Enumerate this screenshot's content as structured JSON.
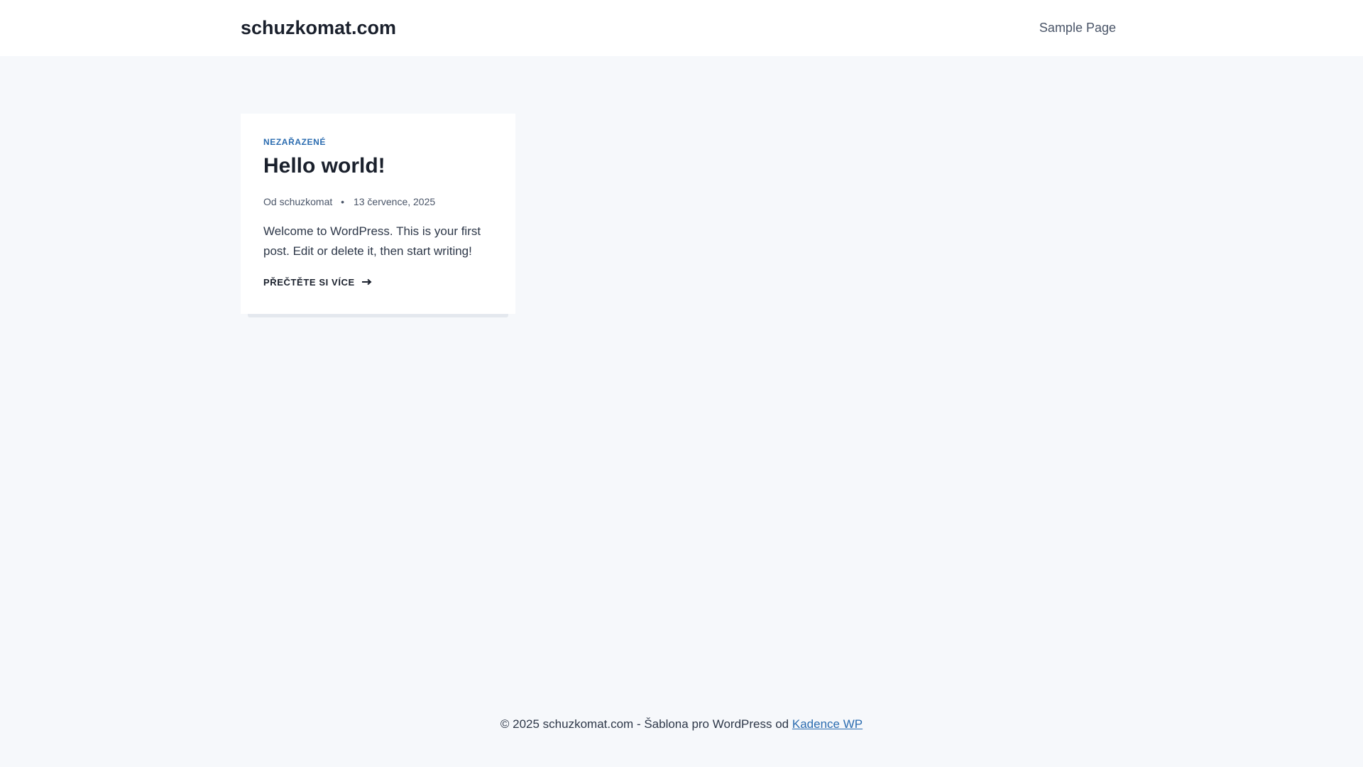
{
  "header": {
    "site_title": "schuzkomat.com",
    "nav": [
      "Sample Page"
    ]
  },
  "post": {
    "category": "NEZAŘAZENÉ",
    "title": "Hello world!",
    "author_prefix": "Od",
    "author": "schuzkomat",
    "separator": "•",
    "date": "13 července, 2025",
    "excerpt": "Welcome to WordPress. This is your first post. Edit or delete it, then start writing!",
    "read_more": "PŘEČTĚTE SI VÍCE"
  },
  "footer": {
    "text": "© 2025 schuzkomat.com - Šablona pro WordPress od",
    "link": "Kadence WP"
  },
  "colors": {
    "page_background": "#f6f8fb",
    "accent": "#2b6cb0",
    "text": "#1a202c"
  },
  "icons": {
    "read_more": "arrow-right-icon"
  }
}
